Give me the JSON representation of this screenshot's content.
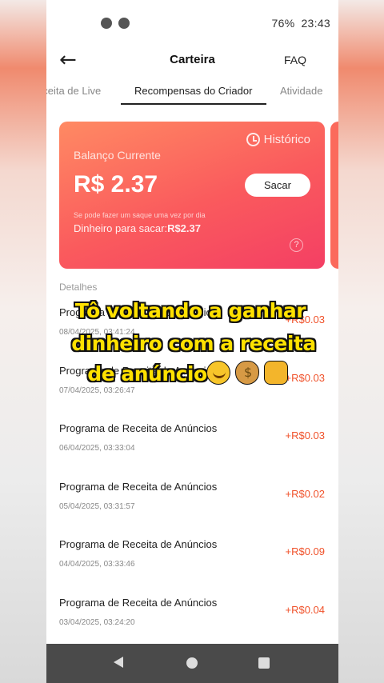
{
  "status_bar": {
    "battery": "76%",
    "time": "23:43"
  },
  "header": {
    "back_icon": "arrow-left-icon",
    "title": "Carteira",
    "faq": "FAQ"
  },
  "tabs": [
    {
      "label": "eceita de Live"
    },
    {
      "label": "Recompensas do Criador",
      "active": true
    },
    {
      "label": "Atividade"
    }
  ],
  "card": {
    "history": "Histórico",
    "balance_label": "Balanço Currente",
    "balance_value": "R$ 2.37",
    "withdraw_button": "Sacar",
    "note": "Se pode fazer um saque uma vez por dia",
    "available_label": "Dinheiro para sacar:",
    "available_value": "R$2.37",
    "help": "?"
  },
  "details": {
    "title": "Detalhes",
    "items": [
      {
        "name": "Programa de Receita de Anúncios",
        "date": "08/04/2025, 03:41:24",
        "amount": "+R$0.03"
      },
      {
        "name": "Programa de Receita de Anúncios",
        "date": "07/04/2025, 03:26:47",
        "amount": "+R$0.03"
      },
      {
        "name": "Programa de Receita de Anúncios",
        "date": "06/04/2025, 03:33:04",
        "amount": "+R$0.03"
      },
      {
        "name": "Programa de Receita de Anúncios",
        "date": "05/04/2025, 03:31:57",
        "amount": "+R$0.02"
      },
      {
        "name": "Programa de Receita de Anúncios",
        "date": "04/04/2025, 03:33:46",
        "amount": "+R$0.09"
      },
      {
        "name": "Programa de Receita de Anúncios",
        "date": "03/04/2025, 03:24:20",
        "amount": "+R$0.04"
      }
    ]
  },
  "caption": {
    "line1": "Tô voltando a ganhar",
    "line2": "dinheiro com a receita",
    "line3": "de anúncio",
    "emojis": [
      "party-face-icon",
      "money-bag-icon",
      "raising-hands-icon"
    ]
  },
  "colors": {
    "accent": "#fa5a5d",
    "amount": "#f0522b",
    "caption": "#ffe100"
  }
}
